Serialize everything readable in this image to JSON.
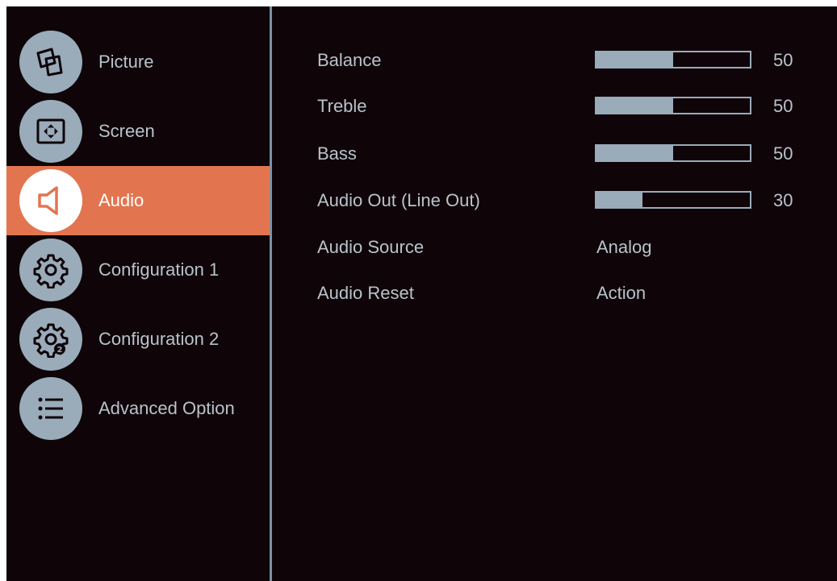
{
  "colors": {
    "background": "#0f0508",
    "accent": "#e2754f",
    "icon_bg": "#9aabba",
    "text": "#b9c2ca"
  },
  "sidebar": {
    "items": [
      {
        "label": "Picture",
        "icon": "picture-icon",
        "active": false
      },
      {
        "label": "Screen",
        "icon": "screen-icon",
        "active": false
      },
      {
        "label": "Audio",
        "icon": "speaker-icon",
        "active": true
      },
      {
        "label": "Configuration 1",
        "icon": "gear-icon",
        "active": false
      },
      {
        "label": "Configuration 2",
        "icon": "gear-2-icon",
        "active": false
      },
      {
        "label": "Advanced Option",
        "icon": "list-icon",
        "active": false
      }
    ]
  },
  "settings": {
    "balance": {
      "label": "Balance",
      "value": 50
    },
    "treble": {
      "label": "Treble",
      "value": 50
    },
    "bass": {
      "label": "Bass",
      "value": 50
    },
    "audio_out": {
      "label": "Audio Out (Line Out)",
      "value": 30
    },
    "audio_source": {
      "label": "Audio Source",
      "value": "Analog"
    },
    "audio_reset": {
      "label": "Audio Reset",
      "value": "Action"
    }
  }
}
